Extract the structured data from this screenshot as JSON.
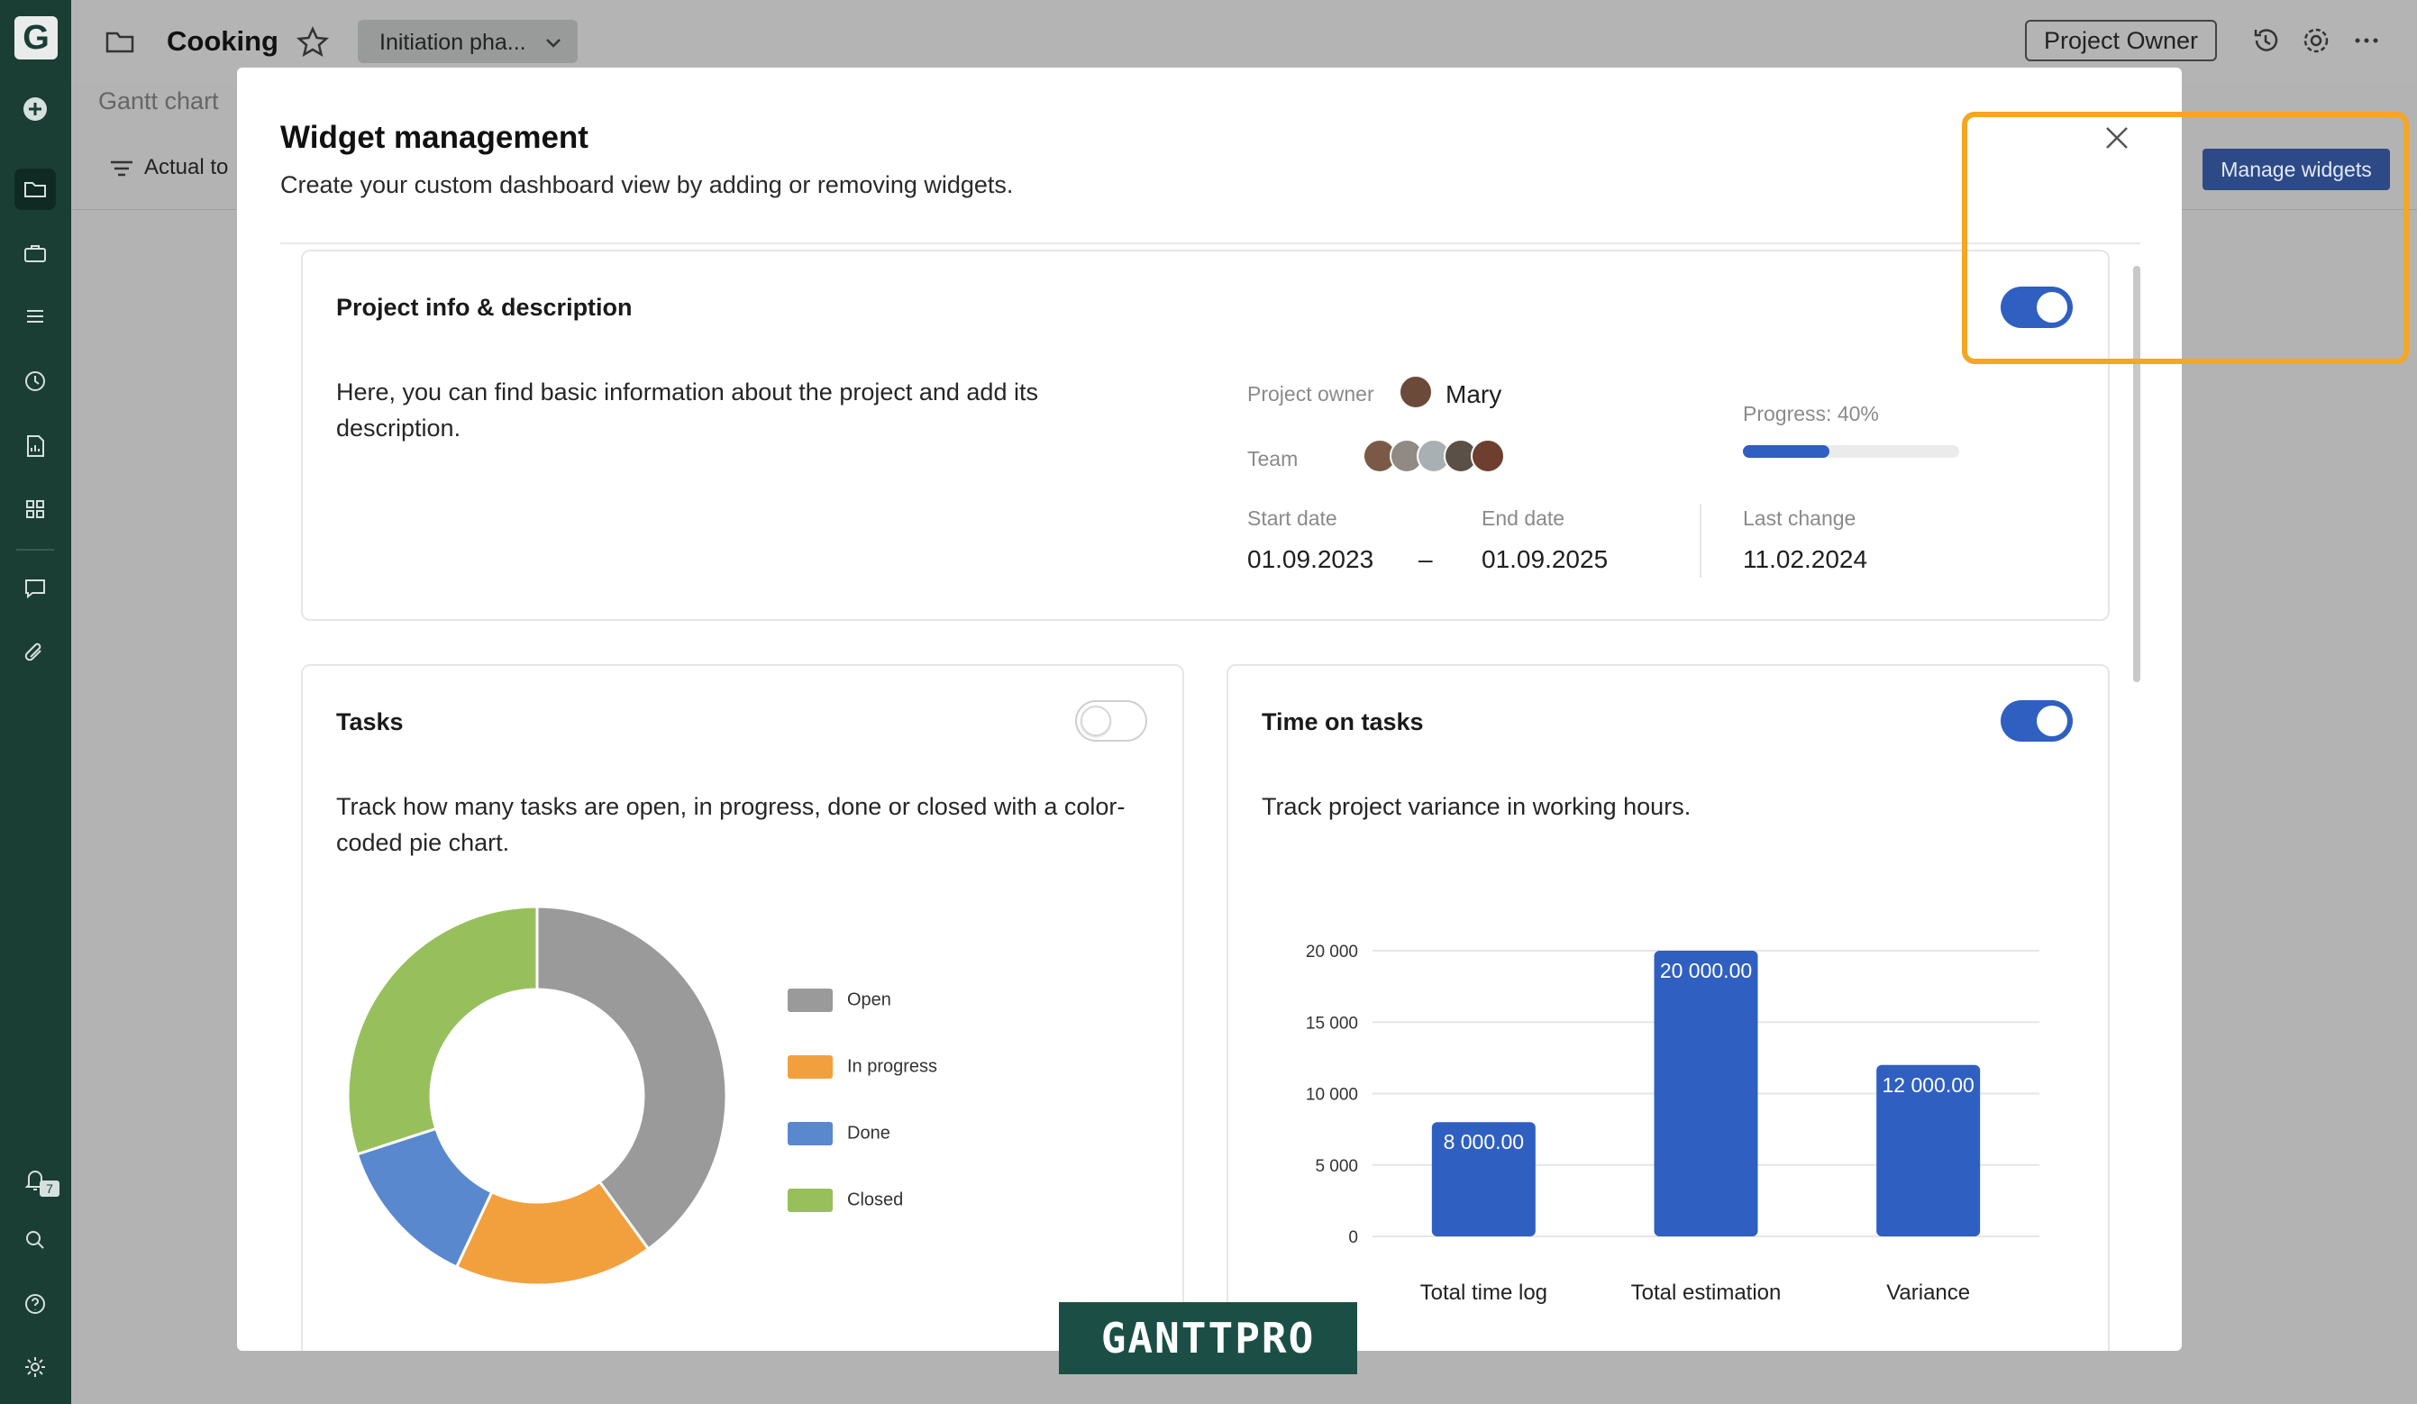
{
  "sidebar": {
    "logo_letter": "G",
    "icons": [
      "add-icon",
      "folder-icon",
      "briefcase-icon",
      "list-icon",
      "clock-icon",
      "report-icon",
      "grid-icon",
      "chat-icon",
      "attachment-icon",
      "bell-icon",
      "search-icon",
      "help-icon",
      "settings-icon"
    ],
    "notification_count": "7"
  },
  "header": {
    "project_title": "Cooking",
    "phase": "Initiation pha...",
    "role_button": "Project Owner",
    "subtab": "Gantt chart",
    "filter_label": "Actual to",
    "manage_widgets": "Manage widgets"
  },
  "modal": {
    "title": "Widget management",
    "subtitle": "Create your custom dashboard view by adding or removing widgets.",
    "widgets": {
      "project_info": {
        "title": "Project info & description",
        "enabled": true,
        "description": "Here, you can find basic information about the project and add its description.",
        "owner_label": "Project owner",
        "owner_name": "Mary",
        "team_label": "Team",
        "team_count": 5,
        "progress_label": "Progress: 40%",
        "progress_value": 0.4,
        "start_label": "Start date",
        "start_date": "01.09.2023",
        "dash": "–",
        "end_label": "End date",
        "end_date": "01.09.2025",
        "last_change_label": "Last change",
        "last_change": "11.02.2024"
      },
      "tasks": {
        "title": "Tasks",
        "enabled": false,
        "description": "Track how many tasks are open, in progress, done or closed with a color-coded pie chart.",
        "legend": [
          {
            "label": "Open",
            "color": "#9a9a9a"
          },
          {
            "label": "In progress",
            "color": "#f2a03d"
          },
          {
            "label": "Done",
            "color": "#5a88cf"
          },
          {
            "label": "Closed",
            "color": "#97c05c"
          }
        ]
      },
      "time_on_tasks": {
        "title": "Time on tasks",
        "enabled": true,
        "description": "Track project variance in working hours."
      }
    }
  },
  "chart_data": [
    {
      "type": "pie",
      "categories": [
        "Open",
        "In progress",
        "Done",
        "Closed"
      ],
      "values": [
        40,
        17,
        13,
        30
      ],
      "colors": [
        "#9a9a9a",
        "#f2a03d",
        "#5a88cf",
        "#97c05c"
      ],
      "title": ""
    },
    {
      "type": "bar",
      "categories": [
        "Total time log",
        "Total estimation",
        "Variance"
      ],
      "values": [
        8000,
        20000,
        12000
      ],
      "value_labels": [
        "8 000.00",
        "20 000.00",
        "12 000.00"
      ],
      "ytick_labels": [
        "0",
        "5 000",
        "10 000",
        "15 000",
        "20 000"
      ],
      "yticks": [
        0,
        5000,
        10000,
        15000,
        20000
      ],
      "ylim": [
        0,
        20000
      ],
      "color": "#2f5fc0",
      "grid": true,
      "title": ""
    }
  ],
  "watermark": "GANTTPRO"
}
